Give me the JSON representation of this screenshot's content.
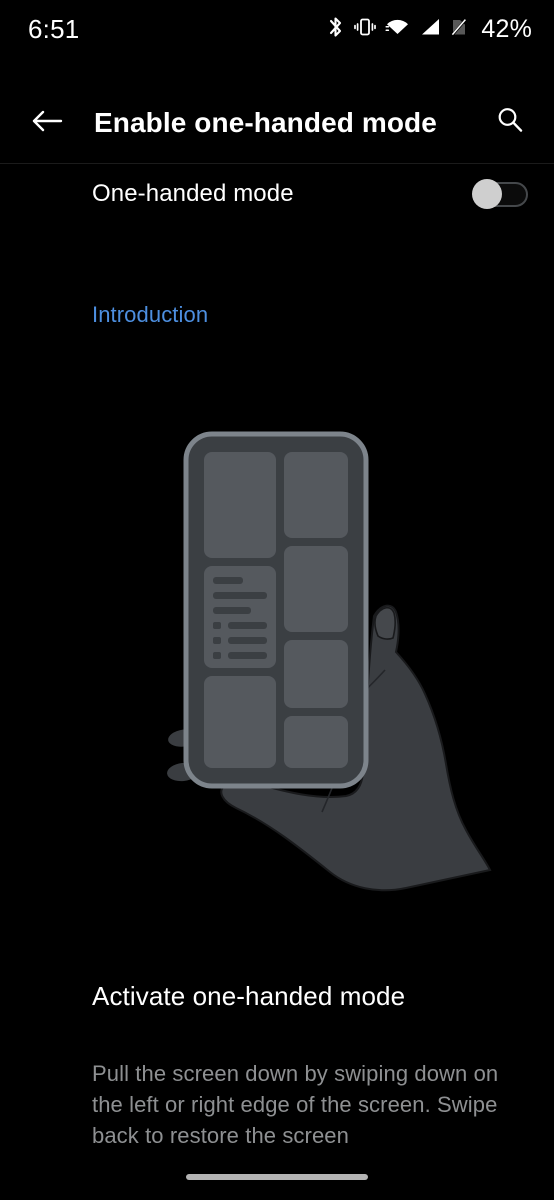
{
  "status_bar": {
    "time": "6:51",
    "battery_percent": "42%",
    "icons": [
      "bluetooth-icon",
      "vibrate-icon",
      "wifi-icon",
      "cellular-signal-icon",
      "sim-off-icon"
    ]
  },
  "app_bar": {
    "back_icon": "back-arrow-icon",
    "title": "Enable one-handed mode",
    "search_icon": "search-icon"
  },
  "switch_row": {
    "label": "One-handed mode",
    "state": "off"
  },
  "section": {
    "label": "Introduction"
  },
  "illustration": {
    "name": "one-handed-mode-illustration",
    "description": "Hand holding a phone with a split card layout"
  },
  "intro_card": {
    "heading": "Activate one-handed mode",
    "body": "Pull the screen down by swiping down on the left or right edge of the screen. Swipe back to restore the screen"
  },
  "navigation": {
    "home_indicator": "gesture-home-indicator"
  },
  "colors": {
    "background": "#000000",
    "accent": "#4d8fe0",
    "primary_text": "#ffffff",
    "secondary_text": "#8e9092",
    "toggle_thumb": "#cfcfcf",
    "phone_body": "#3b3f43",
    "phone_frame": "#7d848b",
    "phone_card": "#55595e",
    "hand": "#3a3d41"
  }
}
